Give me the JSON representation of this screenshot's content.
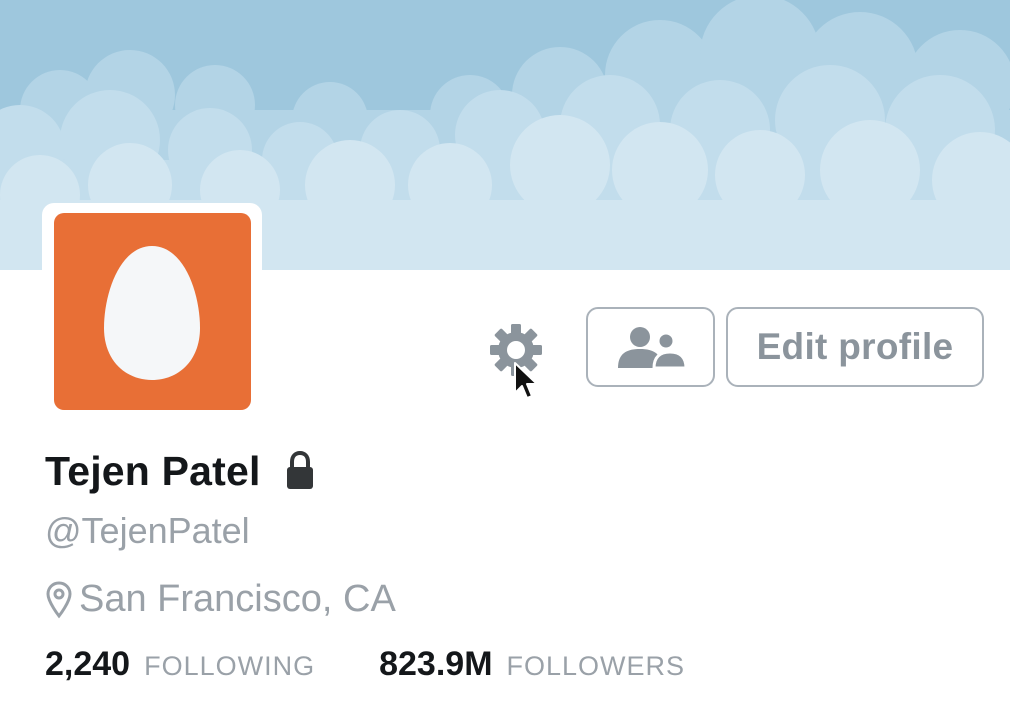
{
  "profile": {
    "name": "Tejen Patel",
    "handle": "@TejenPatel",
    "location": "San Francisco, CA",
    "protected": true
  },
  "actions": {
    "settings_icon": "gear-icon",
    "people_icon": "people-icon",
    "edit_profile_label": "Edit profile"
  },
  "stats": {
    "following_count": "2,240",
    "following_label": "FOLLOWING",
    "followers_count": "823.9M",
    "followers_label": "FOLLOWERS"
  },
  "colors": {
    "avatar_background": "#e86f36",
    "header_sky": "#9ec7dd",
    "muted_text": "#9aa1a8",
    "primary_text": "#14171a"
  }
}
